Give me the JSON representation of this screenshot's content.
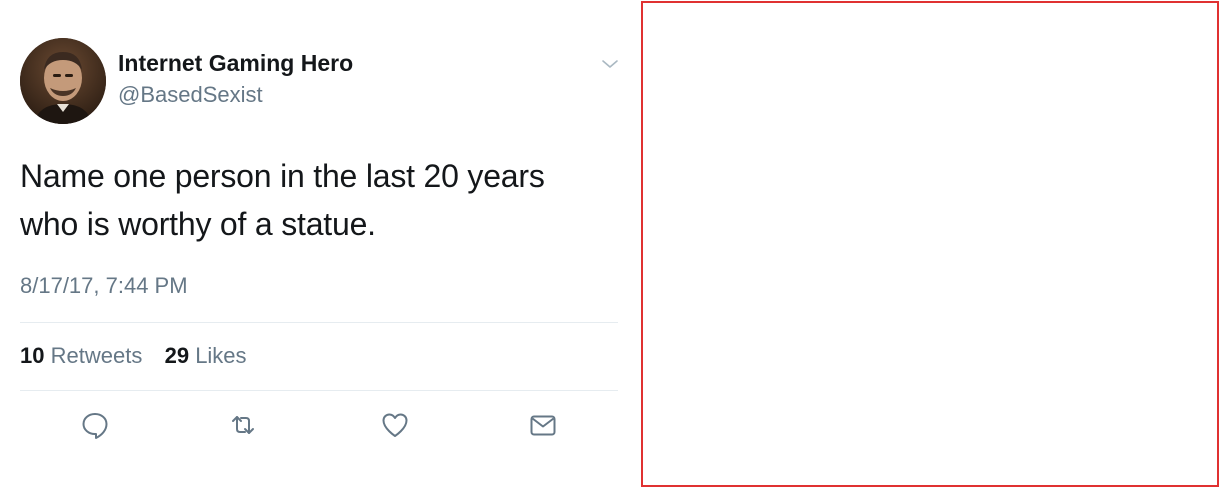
{
  "tweet": {
    "author": {
      "display_name": "Internet Gaming Hero",
      "handle": "@BasedSexist",
      "avatar_icon": "portrait-avatar"
    },
    "text_line1": "Name one person in the last 20 years",
    "text_line2": "who is worthy of a statue.",
    "timestamp": "8/17/17, 7:44 PM",
    "stats": {
      "retweets_count": "10",
      "retweets_label": "Retweets",
      "likes_count": "29",
      "likes_label": "Likes"
    },
    "actions": [
      {
        "name": "reply",
        "icon": "speech-bubble-icon"
      },
      {
        "name": "retweet",
        "icon": "retweet-arrows-icon"
      },
      {
        "name": "like",
        "icon": "heart-icon"
      },
      {
        "name": "direct-message",
        "icon": "envelope-icon"
      }
    ]
  },
  "colors": {
    "text_primary": "#14171a",
    "text_secondary": "#657786",
    "divider": "#e6ecf0",
    "icon": "#657786",
    "panel_border": "#e03131"
  }
}
